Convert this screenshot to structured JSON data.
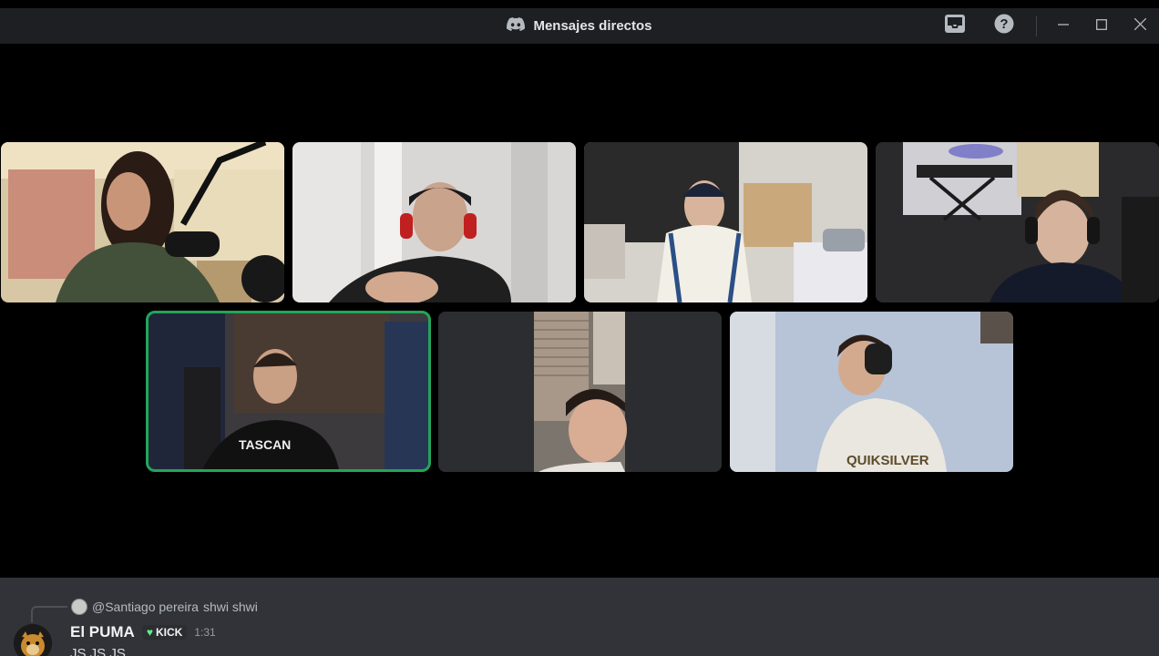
{
  "window": {
    "title": "Mensajes directos",
    "icons": [
      "discord-logo-icon",
      "inbox-icon",
      "help-icon",
      "minimize-icon",
      "maximize-icon",
      "close-icon"
    ]
  },
  "call": {
    "tiles": [
      {
        "name": "participant-1",
        "speaking": false
      },
      {
        "name": "participant-2",
        "speaking": false
      },
      {
        "name": "participant-3",
        "speaking": false
      },
      {
        "name": "participant-4",
        "speaking": false
      },
      {
        "name": "participant-5",
        "speaking": true
      },
      {
        "name": "participant-6",
        "speaking": false
      },
      {
        "name": "participant-7",
        "speaking": false
      }
    ],
    "accent_speaking": "#23a55a"
  },
  "chat": {
    "reply": {
      "mention": "@Santiago pereira",
      "text": "shwi shwi"
    },
    "message": {
      "author": "El PUMA",
      "tag": "KICK",
      "time": "1:31",
      "body": "JS JS JS"
    }
  }
}
